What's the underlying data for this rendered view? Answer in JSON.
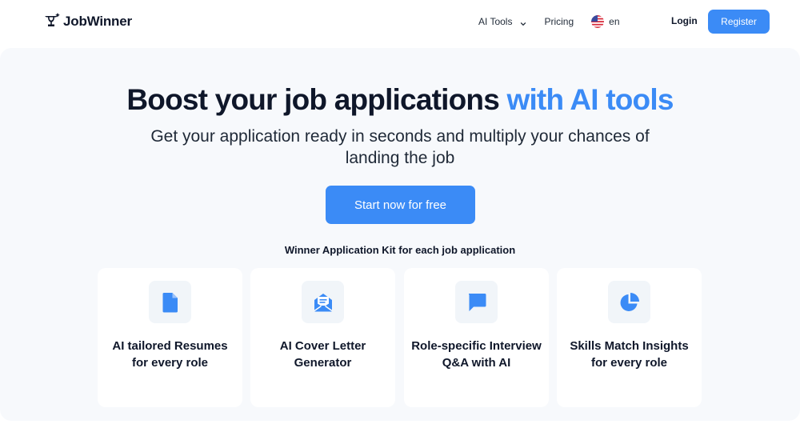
{
  "brand": {
    "name": "JobWinner",
    "logo_icon": "trophy-icon"
  },
  "nav": {
    "ai_tools": "AI Tools",
    "pricing": "Pricing",
    "language": "en",
    "language_flag": "us-flag-icon",
    "login": "Login",
    "register": "Register"
  },
  "hero": {
    "headline_main": "Boost your job applications",
    "headline_accent": "with AI tools",
    "subline": "Get your application ready in seconds and multiply your chances of landing the job",
    "cta": "Start now for free",
    "kit_title": "Winner Application Kit for each job application"
  },
  "features": [
    {
      "icon": "document-icon",
      "label": "AI tailored Resumes for every role"
    },
    {
      "icon": "envelope-icon",
      "label": "AI Cover Letter Generator"
    },
    {
      "icon": "chat-bubble-icon",
      "label": "Role-specific Interview Q&A with AI"
    },
    {
      "icon": "pie-chart-icon",
      "label": "Skills Match Insights for every role"
    }
  ],
  "colors": {
    "accent": "#3b8bf6",
    "hero_background": "#f7f9fc",
    "text": "#0f172a"
  }
}
